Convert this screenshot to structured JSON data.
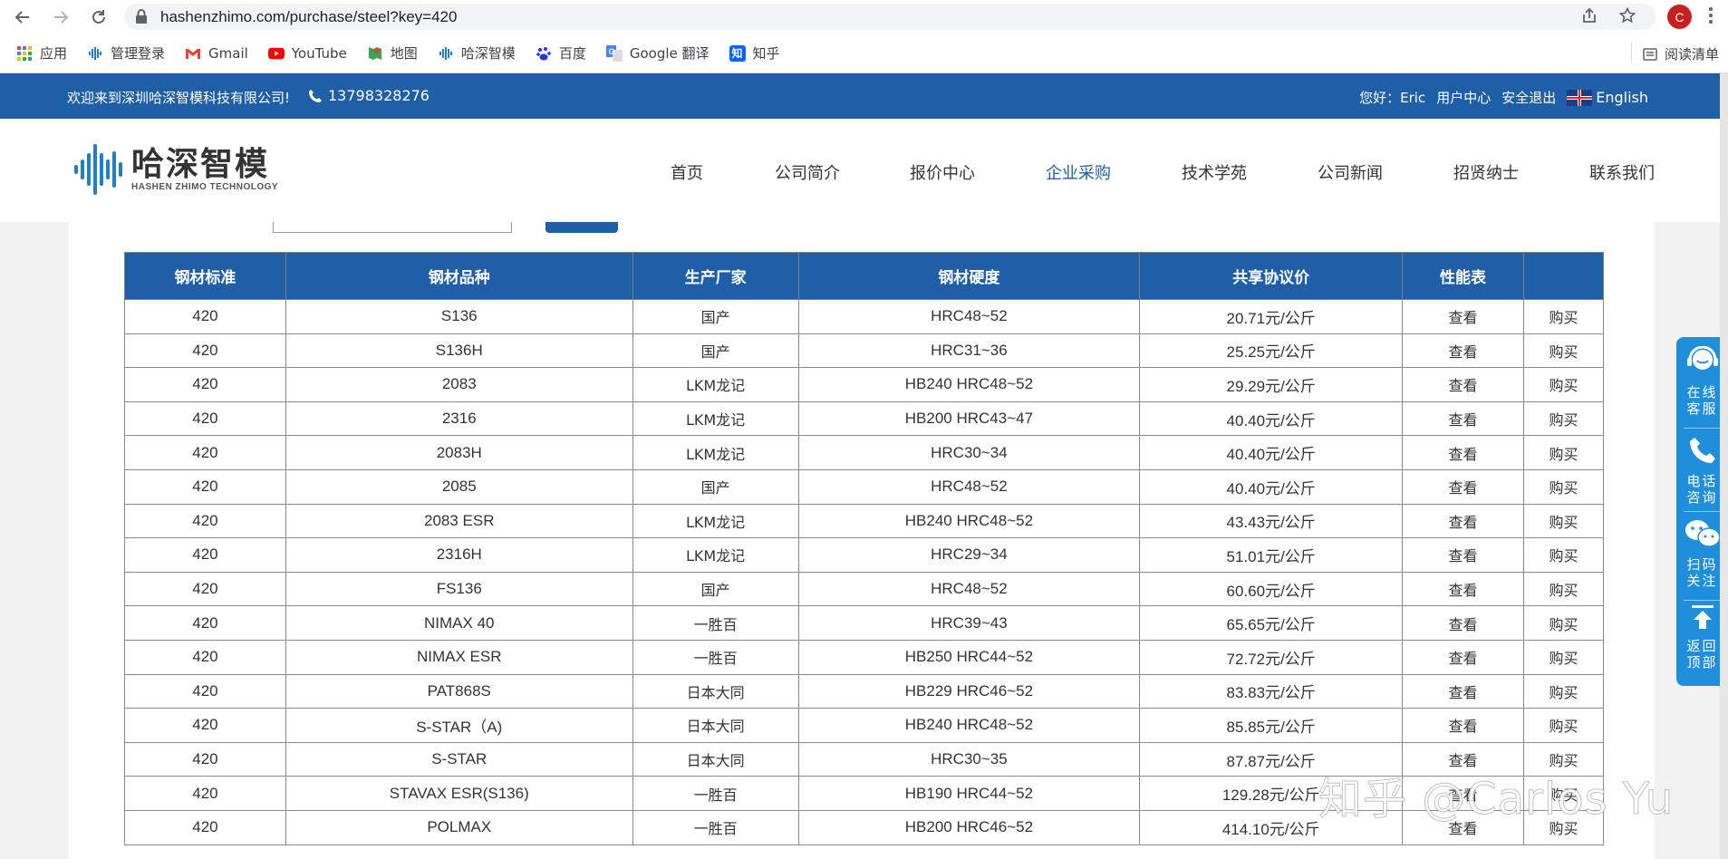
{
  "browser": {
    "url": "hashenzhimo.com/purchase/steel?key=420",
    "avatar_letter": "C",
    "bookmarks": [
      {
        "label": "应用",
        "icon": "apps-grid-icon"
      },
      {
        "label": "管理登录",
        "icon": "site-logo-icon"
      },
      {
        "label": "Gmail",
        "icon": "gmail-icon"
      },
      {
        "label": "YouTube",
        "icon": "youtube-icon"
      },
      {
        "label": "地图",
        "icon": "maps-icon"
      },
      {
        "label": "哈深智模",
        "icon": "site-logo-icon"
      },
      {
        "label": "百度",
        "icon": "baidu-icon"
      },
      {
        "label": "Google 翻译",
        "icon": "translate-icon"
      },
      {
        "label": "知乎",
        "icon": "zhihu-icon"
      }
    ],
    "reading_list": "阅读清单",
    "zhihu_glyph": "知"
  },
  "topbar": {
    "welcome": "欢迎来到深圳哈深智模科技有限公司!",
    "phone": "13798328276",
    "greeting": "您好：Eric",
    "user_center": "用户中心",
    "logout": "安全退出",
    "language": "English"
  },
  "header": {
    "logo_main": "哈深智模",
    "logo_sub": "HASHEN ZHIMO TECHNOLOGY",
    "menu": [
      "首页",
      "公司简介",
      "报价中心",
      "企业采购",
      "技术学苑",
      "公司新闻",
      "招贤纳士",
      "联系我们"
    ],
    "active_menu": "企业采购"
  },
  "table": {
    "headers": [
      "钢材标准",
      "钢材品种",
      "生产厂家",
      "钢材硬度",
      "共享协议价",
      "性能表",
      ""
    ],
    "view_label": "查看",
    "buy_label": "购买",
    "rows": [
      [
        "420",
        "S136",
        "国产",
        "HRC48~52",
        "20.71元/公斤"
      ],
      [
        "420",
        "S136H",
        "国产",
        "HRC31~36",
        "25.25元/公斤"
      ],
      [
        "420",
        "2083",
        "LKM龙记",
        "HB240 HRC48~52",
        "29.29元/公斤"
      ],
      [
        "420",
        "2316",
        "LKM龙记",
        "HB200 HRC43~47",
        "40.40元/公斤"
      ],
      [
        "420",
        "2083H",
        "LKM龙记",
        "HRC30~34",
        "40.40元/公斤"
      ],
      [
        "420",
        "2085",
        "国产",
        "HRC48~52",
        "40.40元/公斤"
      ],
      [
        "420",
        "2083 ESR",
        "LKM龙记",
        "HB240 HRC48~52",
        "43.43元/公斤"
      ],
      [
        "420",
        "2316H",
        "LKM龙记",
        "HRC29~34",
        "51.01元/公斤"
      ],
      [
        "420",
        "FS136",
        "国产",
        "HRC48~52",
        "60.60元/公斤"
      ],
      [
        "420",
        "NIMAX 40",
        "一胜百",
        "HRC39~43",
        "65.65元/公斤"
      ],
      [
        "420",
        "NIMAX ESR",
        "一胜百",
        "HB250 HRC44~52",
        "72.72元/公斤"
      ],
      [
        "420",
        "PAT868S",
        "日本大同",
        "HB229 HRC46~52",
        "83.83元/公斤"
      ],
      [
        "420",
        "S-STAR（A)",
        "日本大同",
        "HB240 HRC48~52",
        "85.85元/公斤"
      ],
      [
        "420",
        "S-STAR",
        "日本大同",
        "HRC30~35",
        "87.87元/公斤"
      ],
      [
        "420",
        "STAVAX ESR(S136)",
        "一胜百",
        "HB190 HRC44~52",
        "129.28元/公斤"
      ],
      [
        "420",
        "POLMAX",
        "一胜百",
        "HB200 HRC46~52",
        "414.10元/公斤"
      ]
    ]
  },
  "side_panel": [
    {
      "label": "在线客服",
      "icon": "customer-service-icon"
    },
    {
      "label": "电话咨询",
      "icon": "phone-icon"
    },
    {
      "label": "扫码关注",
      "icon": "wechat-icon"
    },
    {
      "label": "返回顶部",
      "icon": "arrow-up-icon"
    }
  ],
  "watermark": "知乎 @Carlos Yu",
  "colors": {
    "brand_blue": "#1f5fa8",
    "side_blue": "#1f8fdc",
    "avatar_red": "#c5221f"
  }
}
